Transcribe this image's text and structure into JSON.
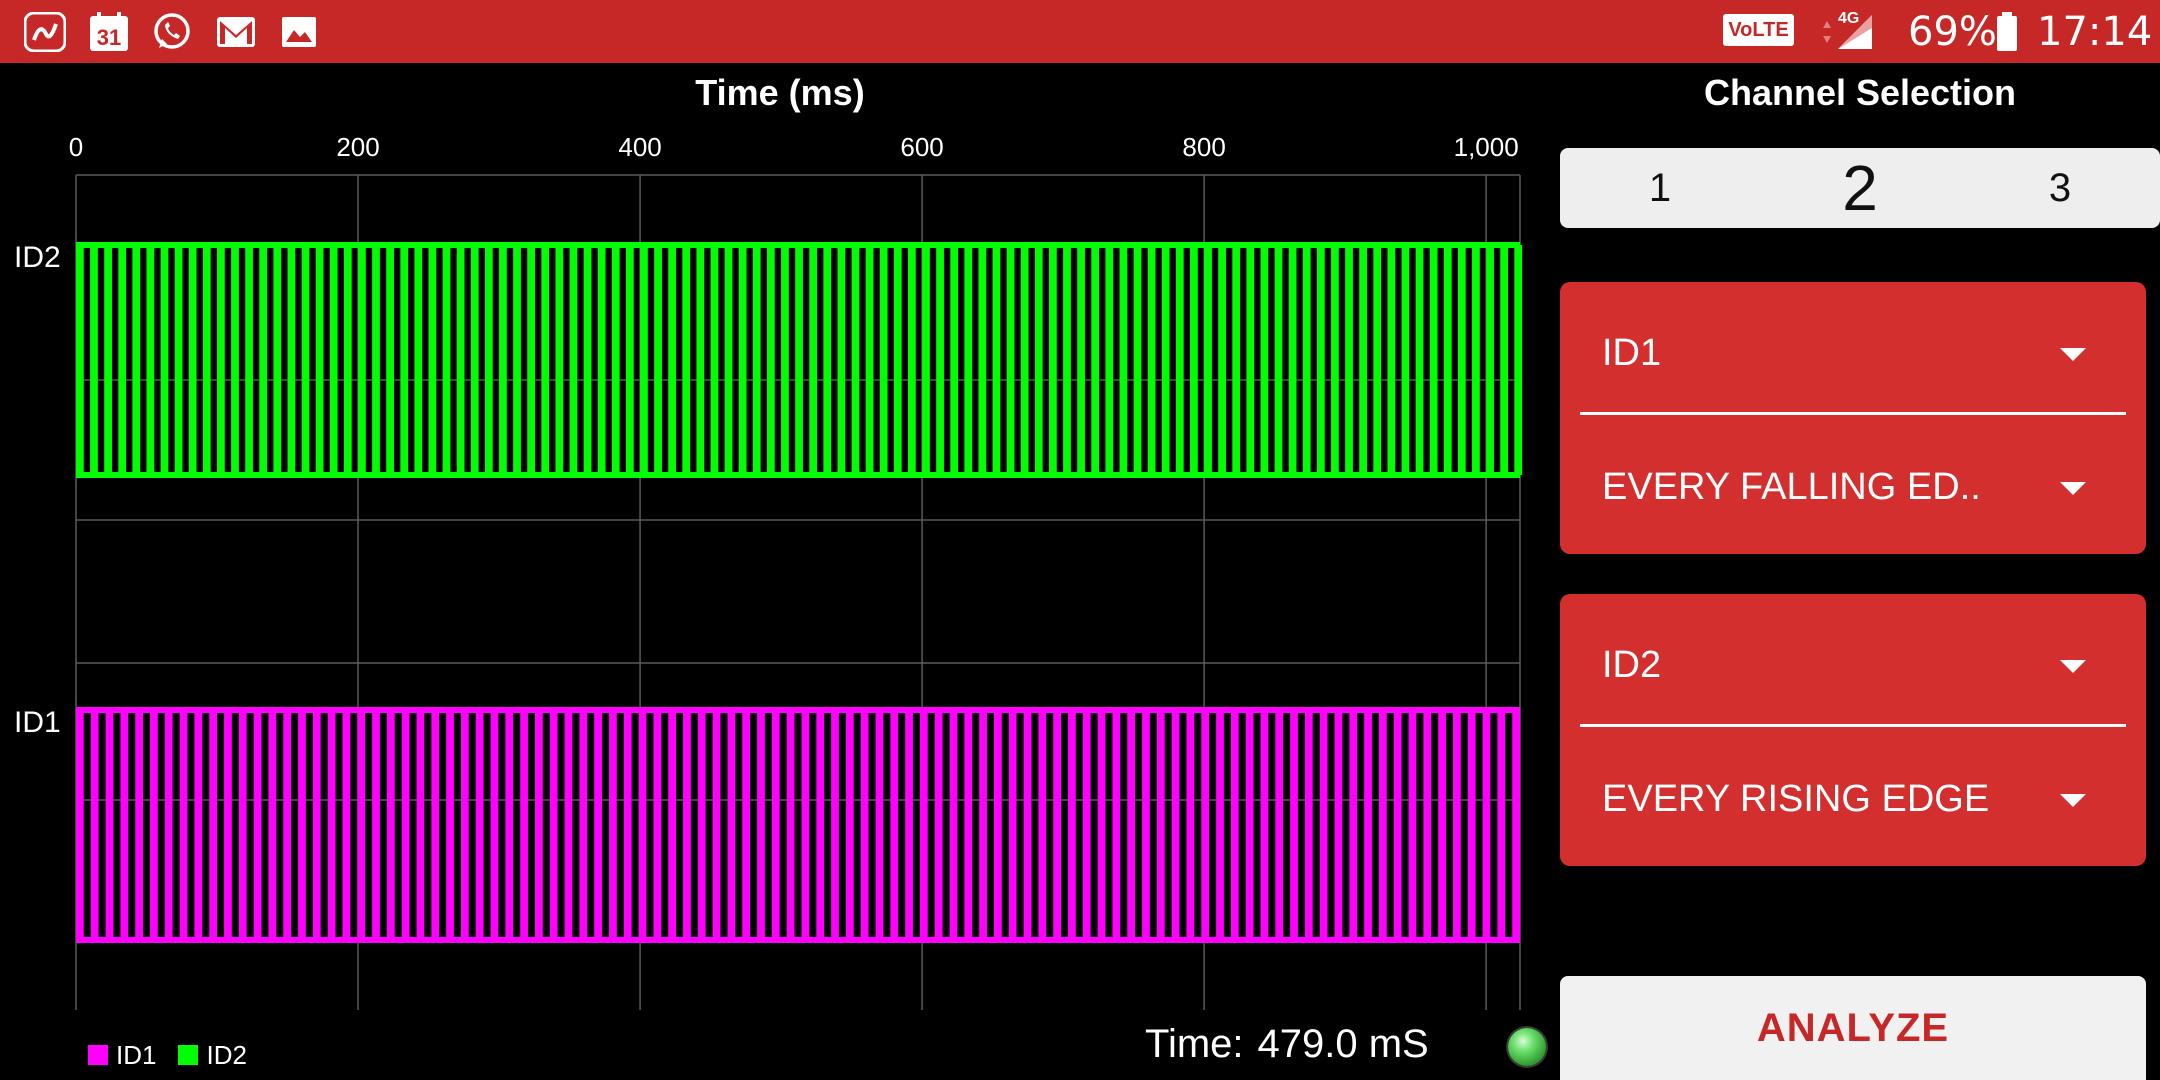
{
  "status_bar": {
    "left_icons": [
      "saavn-app-icon",
      "calendar-icon",
      "whatsapp-icon",
      "gmail-icon",
      "gallery-icon"
    ],
    "calendar_day": "31",
    "volte": "VoLTE",
    "network": "4G",
    "battery": "69%",
    "time": "17:14",
    "bg_color": "#C62828"
  },
  "chart": {
    "title": "Time (ms)",
    "x_ticks": [
      "0",
      "200",
      "400",
      "600",
      "800",
      "1,000"
    ],
    "row_labels": [
      "ID2",
      "ID1"
    ],
    "legend": [
      {
        "label": "ID1",
        "color": "#FF00FF"
      },
      {
        "label": "ID2",
        "color": "#00FF00"
      }
    ],
    "time_label": "Time:",
    "time_value": "479.0 mS"
  },
  "chart_data": {
    "type": "line",
    "title": "Time (ms)",
    "xlabel": "Time (ms)",
    "xlim": [
      0,
      1024
    ],
    "x_tick_values": [
      0,
      200,
      400,
      600,
      800,
      1000
    ],
    "grid": true,
    "legend_position": "bottom-left",
    "series": [
      {
        "name": "ID2",
        "color": "#00FF00",
        "pulse_period_ms": 10.0,
        "pulse_width_ms": 5.5,
        "step": "square-wave"
      },
      {
        "name": "ID1",
        "color": "#FF00FF",
        "pulse_period_ms": 10.5,
        "pulse_width_ms": 5.5,
        "step": "square-wave"
      }
    ]
  },
  "panel": {
    "title": "Channel Selection",
    "tabs": [
      "1",
      "2",
      "3"
    ],
    "active_tab": 1,
    "card1": {
      "id": "ID1",
      "edge": "EVERY FALLING ED.."
    },
    "card2": {
      "id": "ID2",
      "edge": "EVERY RISING EDGE"
    },
    "analyze": "ANALYZE",
    "accent": "#D32F2F"
  }
}
